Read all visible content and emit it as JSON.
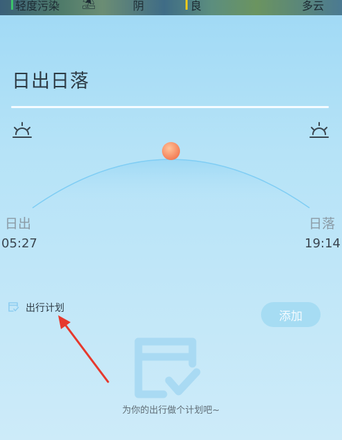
{
  "top_strip": {
    "items": [
      "轻度污染",
      "",
      "阴",
      "良",
      "多云"
    ]
  },
  "sun": {
    "title": "日出日落",
    "sunrise_label": "日出",
    "sunset_label": "日落",
    "sunrise_time": "05:27",
    "sunset_time": "19:14",
    "sun_progress": 0.5
  },
  "plan": {
    "title": "出行计划",
    "add_label": "添加",
    "empty_text": "为你的出行做个计划吧~"
  },
  "colors": {
    "accent_arc": "#7fcdf4",
    "sun_ball": "#f6895f",
    "annotation": "#e6392d"
  },
  "icons": {
    "sunrise": "sunrise-icon",
    "sunset": "sunset-icon",
    "plan": "calendar-check-icon",
    "empty": "calendar-check-illustration"
  }
}
